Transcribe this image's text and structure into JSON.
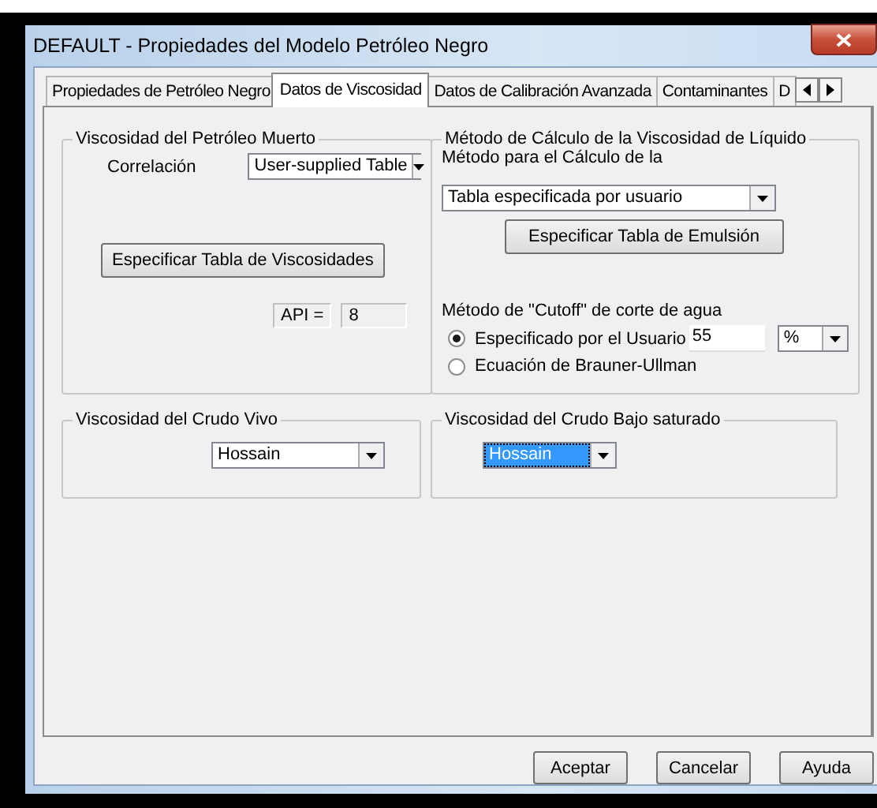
{
  "window": {
    "title": "DEFAULT - Propiedades del Modelo Petróleo Negro"
  },
  "tabs": [
    {
      "label": "Propiedades de Petróleo Negro",
      "selected": false
    },
    {
      "label": "Datos de Viscosidad",
      "selected": true
    },
    {
      "label": "Datos de Calibración Avanzada",
      "selected": false
    },
    {
      "label": "Contaminantes",
      "selected": false
    },
    {
      "label": "D",
      "selected": false
    }
  ],
  "dead_oil": {
    "title": "Viscosidad del Petróleo Muerto",
    "correlation_label": "Correlación",
    "correlation_value": "User-supplied Table",
    "button": "Especificar Tabla de Viscosidades",
    "api_label": "API =",
    "api_value": "8"
  },
  "liquid": {
    "title": "Método de Cálculo de la Viscosidad de Líquido",
    "emulsion_label": "Método para el Cálculo de la",
    "emulsion_value": "Tabla especificada por usuario",
    "button": "Especificar Tabla de Emulsión",
    "cutoff_label": "Método de \"Cutoff\" de corte de agua",
    "options": [
      {
        "label": "Especificado por el Usuario",
        "selected": true
      },
      {
        "label": "Ecuación de Brauner-Ullman",
        "selected": false
      }
    ],
    "cutoff_value": "55",
    "cutoff_unit": "%"
  },
  "live_oil": {
    "title": "Viscosidad del Crudo Vivo",
    "value": "Hossain",
    "focused": false
  },
  "undersaturated": {
    "title": "Viscosidad del Crudo Bajo saturado",
    "value": "Hossain",
    "focused": true
  },
  "buttons": [
    "Aceptar",
    "Cancelar",
    "Ayuda"
  ]
}
